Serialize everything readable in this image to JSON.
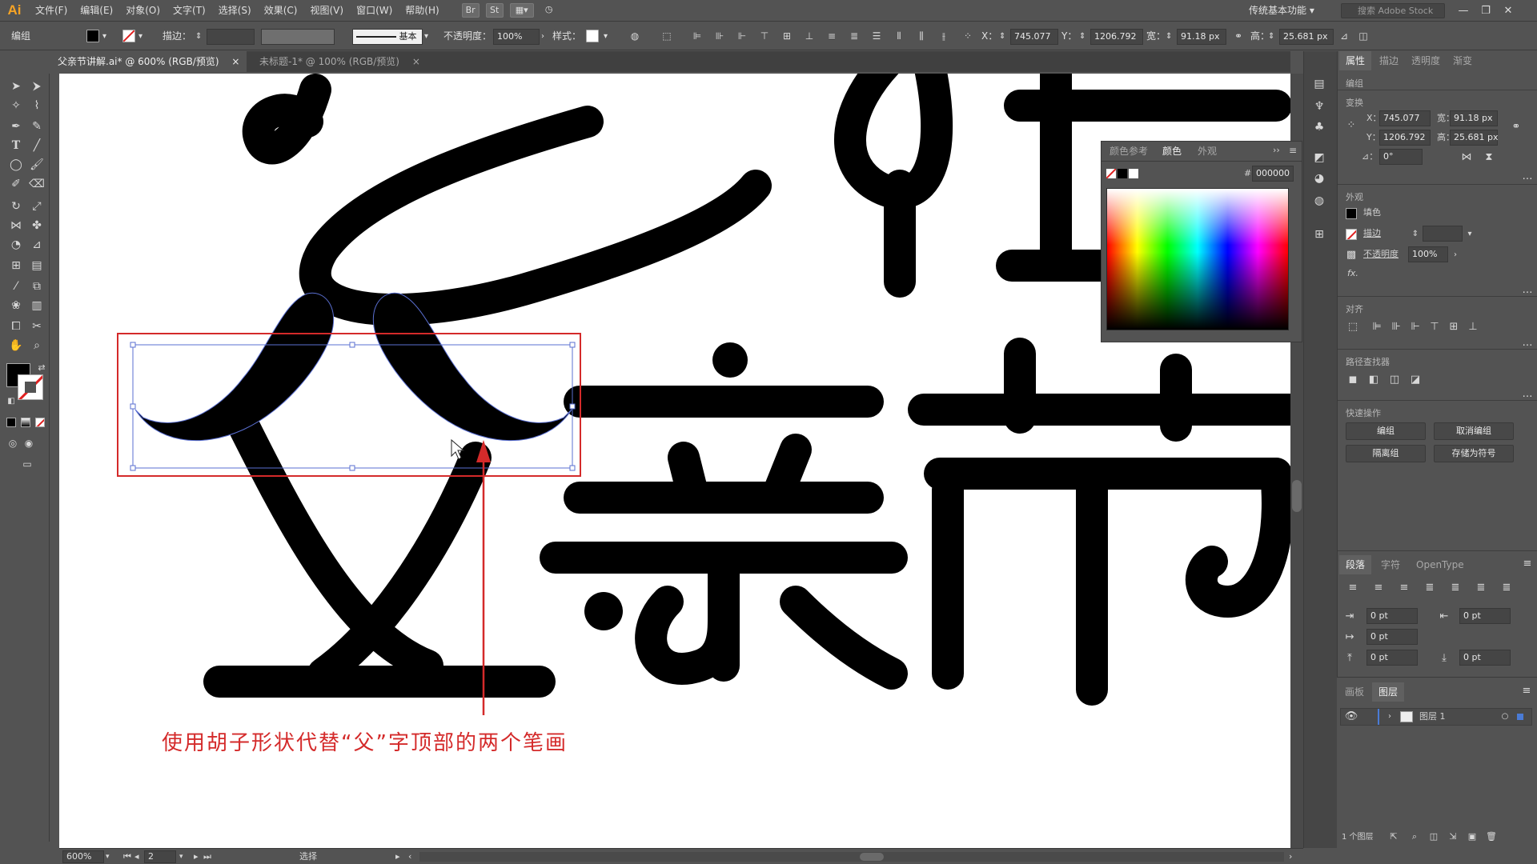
{
  "app": {
    "logo": "Ai",
    "accent": "#f7a425"
  },
  "menu": [
    "文件(F)",
    "编辑(E)",
    "对象(O)",
    "文字(T)",
    "选择(S)",
    "效果(C)",
    "视图(V)",
    "窗口(W)",
    "帮助(H)"
  ],
  "menubar_icons": {
    "bridge": "Br",
    "stock": "St"
  },
  "workspace": "传统基本功能",
  "stock_search": "搜索 Adobe Stock",
  "control_bar": {
    "selection": "编组",
    "stroke_label": "描边：",
    "stroke_profile": "基本",
    "opacity_label": "不透明度：",
    "opacity": "100%",
    "style_label": "样式：",
    "x_label": "X：",
    "x": "745.077",
    "y_label": "Y：",
    "y": "1206.792",
    "w_label": "宽：",
    "w": "91.18 px",
    "h_label": "高：",
    "h": "25.681 px"
  },
  "tabs": [
    {
      "label": "父亲节讲解.ai* @ 600% (RGB/预览)",
      "close": "×"
    },
    {
      "label": "未标题-1* @ 100% (RGB/预览)",
      "close": "×"
    }
  ],
  "artwork": {
    "annotation": "使用胡子形状代替“父”字顶部的两个笔画",
    "annotation_color": "#d42a2a",
    "ink_color": "#000000",
    "selection_color": "#5a6fd1"
  },
  "color_panel": {
    "tabs": [
      "颜色参考",
      "颜色",
      "外观"
    ],
    "hex_label": "#",
    "hex": "000000"
  },
  "properties": {
    "tabs": [
      "属性",
      "描边",
      "透明度",
      "渐变"
    ],
    "group_label": "编组",
    "transform_label": "变换",
    "x_label": "X：",
    "x": "745.077",
    "y_label": "Y：",
    "y": "1206.792",
    "w_label": "宽：",
    "w": "91.18 px",
    "h_label": "高：",
    "h": "25.681 px",
    "angle_label": "⊿：",
    "angle": "0°",
    "appearance_label": "外观",
    "fill_label": "填色",
    "stroke_label": "描边",
    "opacity_label": "不透明度",
    "opacity": "100%",
    "fx": "fx.",
    "align_label": "对齐",
    "pathfinder_label": "路径查找器",
    "quick_actions_label": "快速操作",
    "buttons": [
      "编组",
      "取消编组",
      "隔离组",
      "存储为符号"
    ]
  },
  "paragraph_panel": {
    "tabs": [
      "段落",
      "字符",
      "OpenType"
    ],
    "fields": [
      "0 pt",
      "0 pt",
      "0 pt",
      "0 pt",
      "0 pt"
    ]
  },
  "layers_panel": {
    "tabs": [
      "画板",
      "图层"
    ],
    "layer_name": "图层 1",
    "footer": "1 个图层"
  },
  "status_bar": {
    "zoom": "600%",
    "artboard": "2",
    "tool": "选择"
  }
}
